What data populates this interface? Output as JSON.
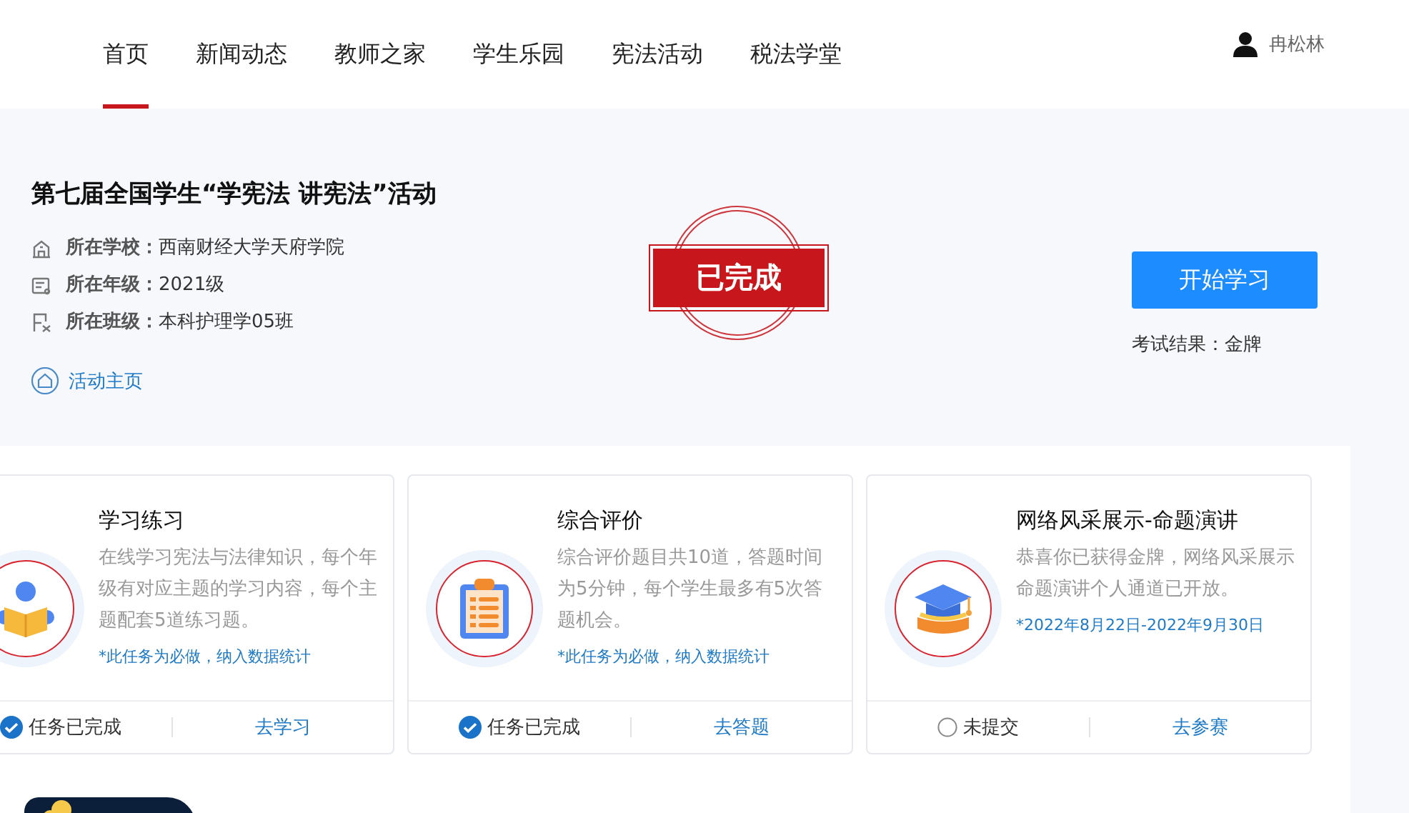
{
  "nav": {
    "items": [
      {
        "label": "首页",
        "selected": true
      },
      {
        "label": "新闻动态",
        "selected": false
      },
      {
        "label": "教师之家",
        "selected": false
      },
      {
        "label": "学生乐园",
        "selected": false
      },
      {
        "label": "宪法活动",
        "selected": false
      },
      {
        "label": "税法学堂",
        "selected": false
      }
    ],
    "user": "冉松林"
  },
  "activity": {
    "title": "第七届全国学生“学宪法 讲宪法”活动",
    "info": [
      {
        "kind": "school",
        "label": "所在学校：",
        "value": "西南财经大学天府学院"
      },
      {
        "kind": "grade",
        "label": "所在年级：",
        "value": "2021级"
      },
      {
        "kind": "class",
        "label": "所在班级：",
        "value": "本科护理学05班"
      }
    ],
    "home_link": "活动主页",
    "stamp": "已完成",
    "start_button": "开始学习",
    "result": "考试结果：金牌"
  },
  "tasks": [
    {
      "kind": "study",
      "title": "学习练习",
      "description": "在线学习宪法与法律知识，每个年级有对应主题的学习内容，每个主题配套5道练习题。",
      "note": "*此任务为必做，纳入数据统计",
      "status": "任务已完成",
      "done": true,
      "action": "去学习"
    },
    {
      "kind": "exam",
      "title": "综合评价",
      "description": "综合评价题目共10道，答题时间为5分钟，每个学生最多有5次答题机会。",
      "note": "*此任务为必做，纳入数据统计",
      "status": "任务已完成",
      "done": true,
      "action": "去答题"
    },
    {
      "kind": "speech",
      "title": "网络风采展示-命题演讲",
      "description": "恭喜你已获得金牌，网络风采展示命题演讲个人通道已开放。",
      "note": "*2022年8月22日-2022年9月30日",
      "status": "未提交",
      "done": false,
      "action": "去参赛"
    }
  ]
}
